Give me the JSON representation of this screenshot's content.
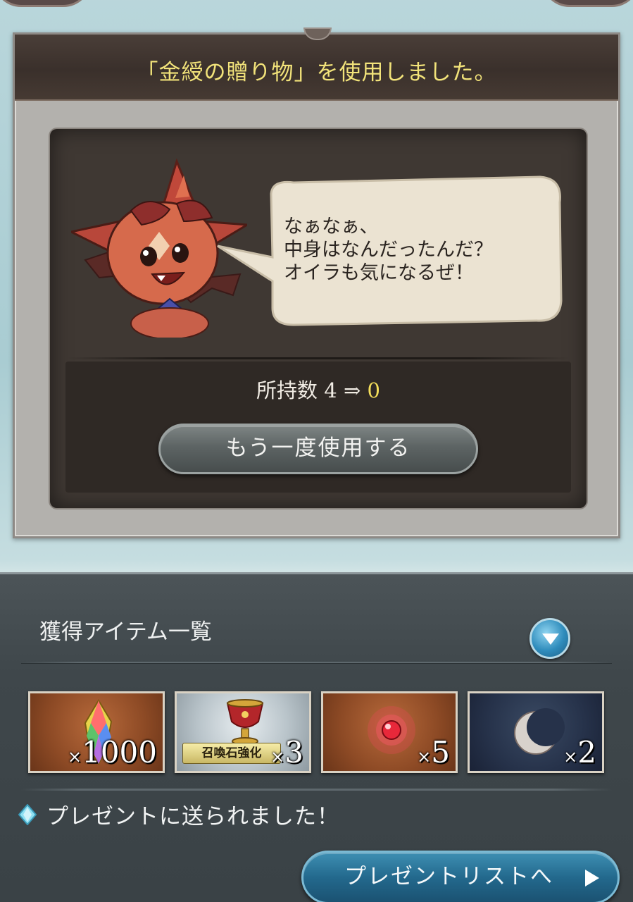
{
  "dialog": {
    "title": "「金綬の贈り物」を使用しました。",
    "speech": {
      "line1": "なぁなぁ、",
      "line2": "中身はなんだったんだ？",
      "line3": "オイラも気になるぜ！"
    },
    "count": {
      "label": "所持数",
      "from": "4",
      "arrow": "⇒",
      "to": "0"
    },
    "use_again_label": "もう一度使用する"
  },
  "obtained": {
    "title": "獲得アイテム一覧",
    "items": [
      {
        "icon": "crystal-icon",
        "x": "×",
        "qty": "1000"
      },
      {
        "icon": "chalice-icon",
        "strip": "召喚石強化",
        "x": "×",
        "qty": "3"
      },
      {
        "icon": "red-orb-icon",
        "x": "×",
        "qty": "5"
      },
      {
        "icon": "crescent-moon-icon",
        "x": "×",
        "qty": "2"
      }
    ],
    "sent_message": "プレゼントに送られました！",
    "present_button_label": "プレゼントリストへ"
  },
  "colors": {
    "title_yellow": "#f2e37a",
    "count_highlight": "#f4de5a",
    "accent_blue": "#2f8cbc"
  }
}
